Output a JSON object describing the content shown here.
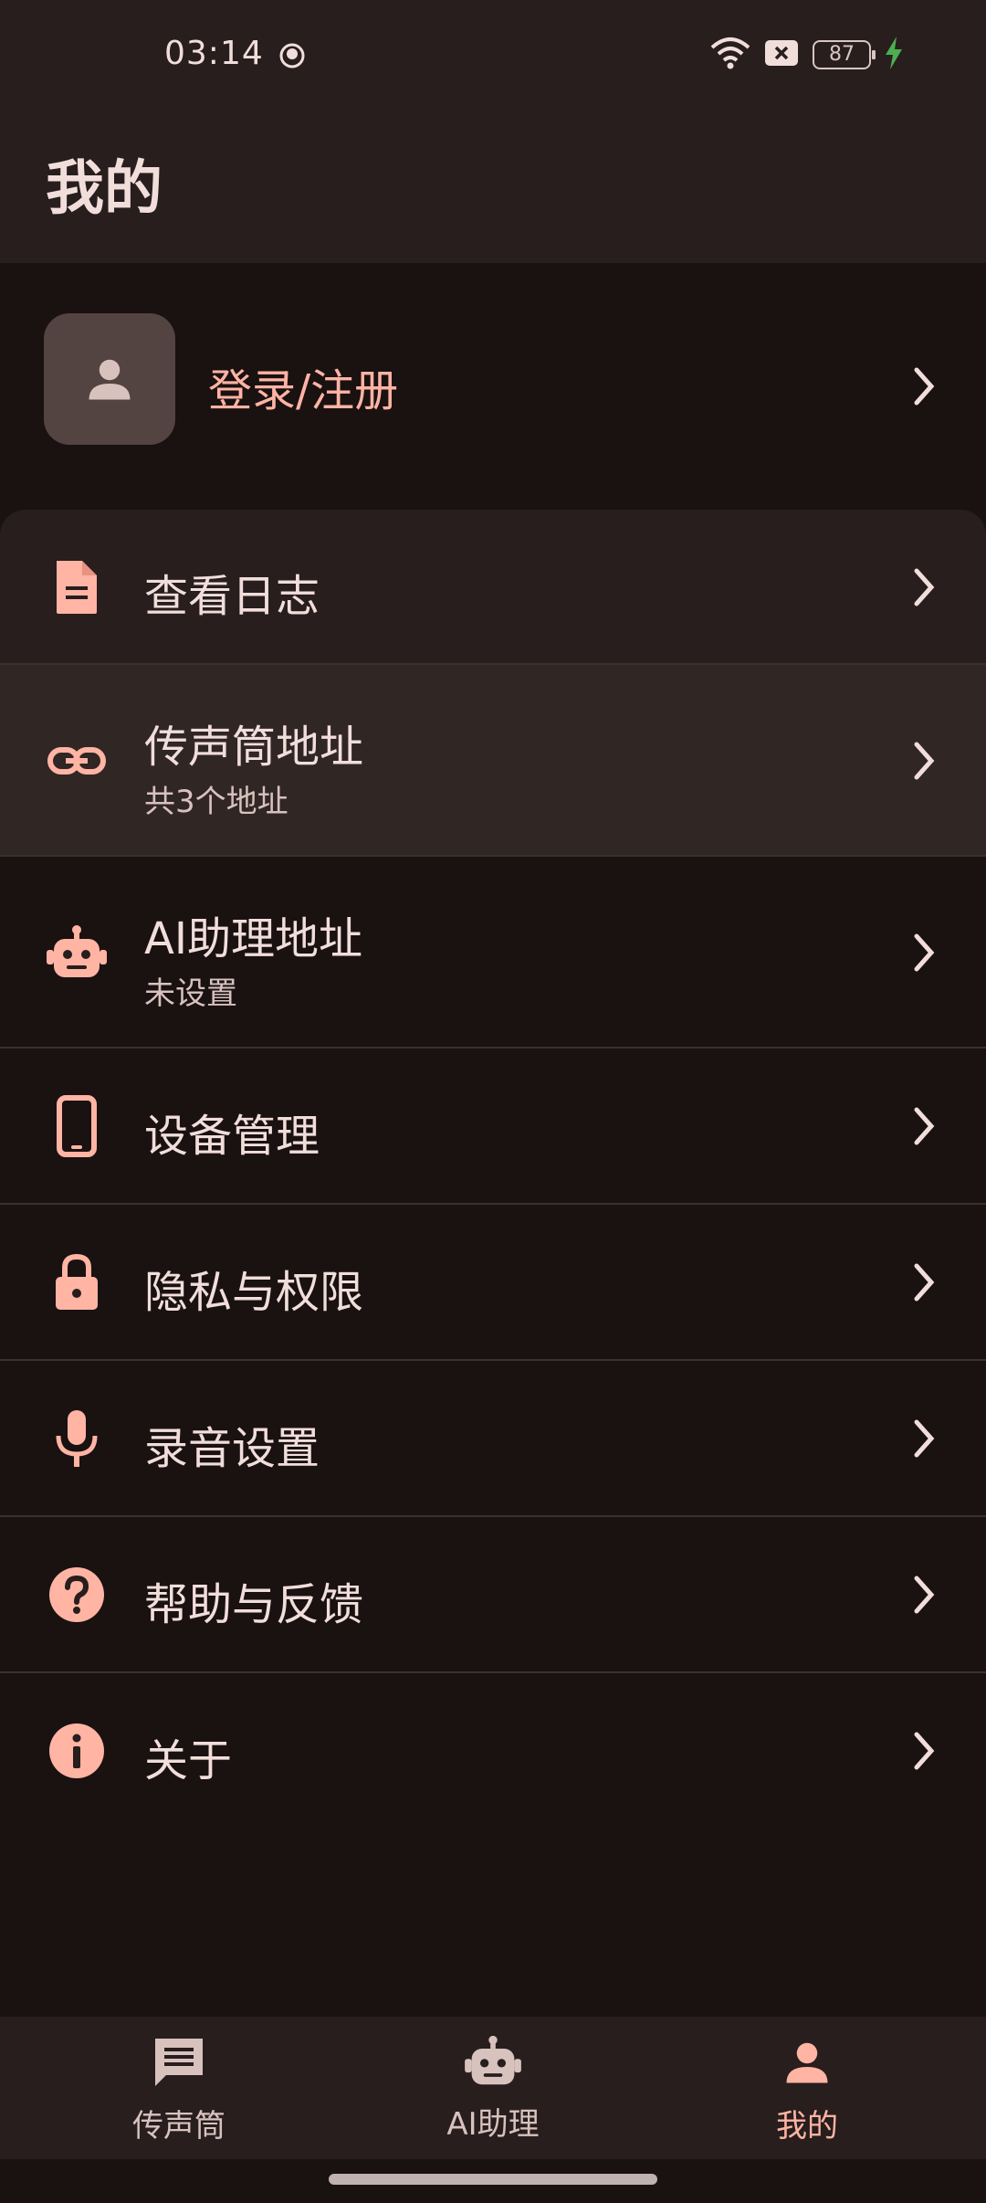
{
  "status_bar": {
    "time": "03:14",
    "battery": "87"
  },
  "header": {
    "title": "我的"
  },
  "login": {
    "label": "登录/注册"
  },
  "menu": [
    {
      "label": "查看日志",
      "sub": "",
      "icon": "document-icon"
    },
    {
      "label": "传声筒地址",
      "sub": "共3个地址",
      "icon": "link-icon"
    },
    {
      "label": "AI助理地址",
      "sub": "未设置",
      "icon": "robot-icon"
    },
    {
      "label": "设备管理",
      "sub": "",
      "icon": "phone-icon"
    },
    {
      "label": "隐私与权限",
      "sub": "",
      "icon": "lock-icon"
    },
    {
      "label": "录音设置",
      "sub": "",
      "icon": "mic-icon"
    },
    {
      "label": "帮助与反馈",
      "sub": "",
      "icon": "help-icon"
    },
    {
      "label": "关于",
      "sub": "",
      "icon": "info-icon"
    }
  ],
  "bottom_nav": [
    {
      "label": "传声筒",
      "icon": "chat-icon"
    },
    {
      "label": "AI助理",
      "icon": "robot-icon"
    },
    {
      "label": "我的",
      "icon": "person-icon"
    }
  ],
  "colors": {
    "accent": "#ffb4a4",
    "background": "#1a1111",
    "surface": "#271e1d",
    "text": "#f1dedb",
    "divider": "#3a302e"
  }
}
